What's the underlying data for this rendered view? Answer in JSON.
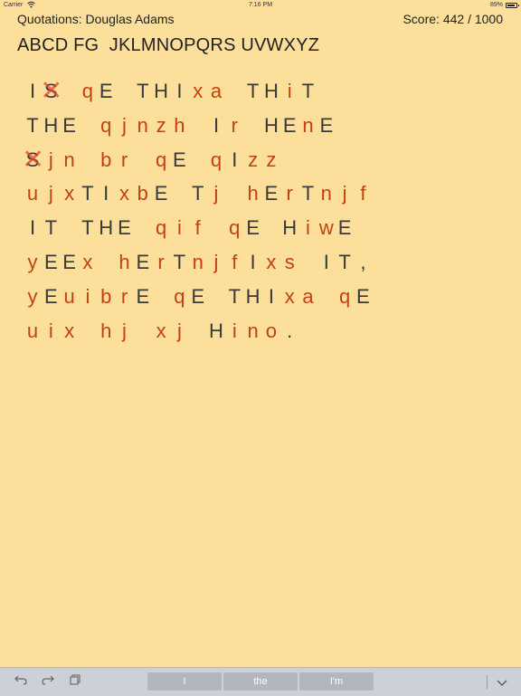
{
  "status_bar": {
    "carrier": "Carrier",
    "time": "7:16 PM",
    "battery": "89%"
  },
  "header": {
    "title": "Quotations: Douglas Adams",
    "score": "Score: 442 / 1000"
  },
  "alphabet": "ABCD FG  JKLMNOPQRS UVWXYZ",
  "puzzle": {
    "lines": [
      [
        [
          "I",
          "k"
        ],
        [
          "S",
          "k",
          "x"
        ],
        [
          " ",
          ""
        ],
        [
          "q",
          "u",
          "g"
        ],
        [
          "E",
          "k"
        ],
        [
          " ",
          ""
        ],
        [
          "T",
          "k"
        ],
        [
          "H",
          "k"
        ],
        [
          "I",
          "k"
        ],
        [
          "x",
          "u"
        ],
        [
          "a",
          "u"
        ],
        [
          " ",
          ""
        ],
        [
          "T",
          "k"
        ],
        [
          "H",
          "k"
        ],
        [
          "i",
          "u"
        ],
        [
          "T",
          "k"
        ]
      ],
      [
        [
          "T",
          "k"
        ],
        [
          "H",
          "k"
        ],
        [
          "E",
          "k"
        ],
        [
          " ",
          ""
        ],
        [
          "q",
          "u"
        ],
        [
          "j",
          "u"
        ],
        [
          "n",
          "u"
        ],
        [
          "z",
          "u"
        ],
        [
          "h",
          "u"
        ],
        [
          " ",
          ""
        ],
        [
          "I",
          "k"
        ],
        [
          "r",
          "u"
        ],
        [
          " ",
          ""
        ],
        [
          "H",
          "k"
        ],
        [
          "E",
          "k"
        ],
        [
          "n",
          "u"
        ],
        [
          "E",
          "k"
        ]
      ],
      [
        [
          "S",
          "k",
          "x"
        ],
        [
          "j",
          "u"
        ],
        [
          "n",
          "u"
        ],
        [
          " ",
          ""
        ],
        [
          "b",
          "u"
        ],
        [
          "r",
          "u"
        ],
        [
          " ",
          ""
        ],
        [
          "q",
          "u",
          "g"
        ],
        [
          "E",
          "k"
        ],
        [
          " ",
          ""
        ],
        [
          "q",
          "u"
        ],
        [
          "I",
          "k"
        ],
        [
          "z",
          "u"
        ],
        [
          "z",
          "u"
        ]
      ],
      [
        [
          "u",
          "u"
        ],
        [
          "j",
          "u"
        ],
        [
          "x",
          "u"
        ],
        [
          "T",
          "k"
        ],
        [
          "I",
          "k"
        ],
        [
          "x",
          "u"
        ],
        [
          "b",
          "u"
        ],
        [
          "E",
          "k"
        ],
        [
          " ",
          ""
        ],
        [
          "T",
          "k"
        ],
        [
          "j",
          "u"
        ],
        [
          " ",
          ""
        ],
        [
          "h",
          "u"
        ],
        [
          "E",
          "k"
        ],
        [
          "r",
          "u"
        ],
        [
          "T",
          "k"
        ],
        [
          "n",
          "u"
        ],
        [
          "j",
          "u"
        ],
        [
          "f",
          "u"
        ]
      ],
      [
        [
          "I",
          "k"
        ],
        [
          "T",
          "k"
        ],
        [
          " ",
          ""
        ],
        [
          "T",
          "k"
        ],
        [
          "H",
          "k"
        ],
        [
          "E",
          "k"
        ],
        [
          " ",
          ""
        ],
        [
          "q",
          "u",
          "g"
        ],
        [
          "i",
          "u"
        ],
        [
          "f",
          "u"
        ],
        [
          " ",
          ""
        ],
        [
          "q",
          "u",
          "g"
        ],
        [
          "E",
          "k"
        ],
        [
          " ",
          ""
        ],
        [
          "H",
          "k"
        ],
        [
          "i",
          "u"
        ],
        [
          "w",
          "u"
        ],
        [
          "E",
          "k"
        ]
      ],
      [
        [
          "y",
          "u"
        ],
        [
          "E",
          "k"
        ],
        [
          "E",
          "k"
        ],
        [
          "x",
          "u"
        ],
        [
          " ",
          ""
        ],
        [
          "h",
          "u"
        ],
        [
          "E",
          "k"
        ],
        [
          "r",
          "u"
        ],
        [
          "T",
          "k"
        ],
        [
          "n",
          "u"
        ],
        [
          "j",
          "u"
        ],
        [
          "f",
          "u"
        ],
        [
          "I",
          "k"
        ],
        [
          "x",
          "u"
        ],
        [
          "s",
          "u"
        ],
        [
          " ",
          ""
        ],
        [
          "I",
          "k"
        ],
        [
          "T",
          "k"
        ],
        [
          ",",
          "k"
        ]
      ],
      [
        [
          "y",
          "u"
        ],
        [
          "E",
          "k"
        ],
        [
          "u",
          "u"
        ],
        [
          "i",
          "u"
        ],
        [
          "b",
          "u"
        ],
        [
          "r",
          "u"
        ],
        [
          "E",
          "k"
        ],
        [
          " ",
          ""
        ],
        [
          "q",
          "u",
          "g"
        ],
        [
          "E",
          "k"
        ],
        [
          " ",
          ""
        ],
        [
          "T",
          "k"
        ],
        [
          "H",
          "k"
        ],
        [
          "I",
          "k"
        ],
        [
          "x",
          "u"
        ],
        [
          "a",
          "u"
        ],
        [
          " ",
          ""
        ],
        [
          "q",
          "u",
          "g"
        ],
        [
          "E",
          "k"
        ]
      ],
      [
        [
          "u",
          "u"
        ],
        [
          "i",
          "u"
        ],
        [
          "x",
          "u"
        ],
        [
          " ",
          ""
        ],
        [
          "h",
          "u"
        ],
        [
          "j",
          "u"
        ],
        [
          " ",
          ""
        ],
        [
          "x",
          "u"
        ],
        [
          "j",
          "u"
        ],
        [
          " ",
          ""
        ],
        [
          "H",
          "k"
        ],
        [
          "i",
          "u"
        ],
        [
          "n",
          "u"
        ],
        [
          "o",
          "u"
        ],
        [
          ".",
          "k"
        ]
      ]
    ]
  },
  "keyboard_bar": {
    "undo_icon": "undo-icon",
    "redo_icon": "redo-icon",
    "paste_icon": "paste-icon",
    "suggestions": [
      "I",
      "the",
      "I'm"
    ],
    "dismiss_icon": "chevron-down-icon"
  }
}
